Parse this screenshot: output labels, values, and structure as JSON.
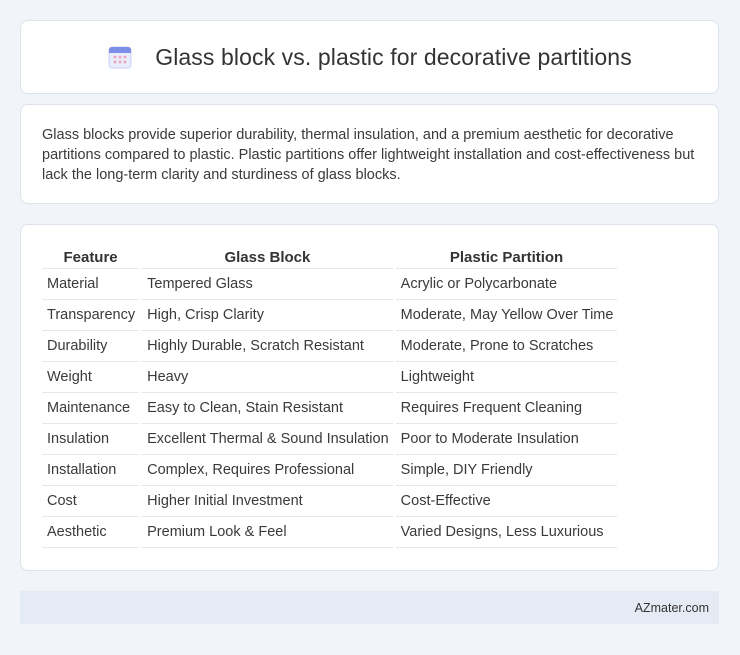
{
  "header": {
    "title": "Glass block vs. plastic for decorative partitions",
    "icon": "calendar-icon"
  },
  "intro": {
    "text": "Glass blocks provide superior durability, thermal insulation, and a premium aesthetic for decorative partitions compared to plastic. Plastic partitions offer lightweight installation and cost-effectiveness but lack the long-term clarity and sturdiness of glass blocks."
  },
  "table": {
    "headers": [
      "Feature",
      "Glass Block",
      "Plastic Partition"
    ],
    "rows": [
      [
        "Material",
        "Tempered Glass",
        "Acrylic or Polycarbonate"
      ],
      [
        "Transparency",
        "High, Crisp Clarity",
        "Moderate, May Yellow Over Time"
      ],
      [
        "Durability",
        "Highly Durable, Scratch Resistant",
        "Moderate, Prone to Scratches"
      ],
      [
        "Weight",
        "Heavy",
        "Lightweight"
      ],
      [
        "Maintenance",
        "Easy to Clean, Stain Resistant",
        "Requires Frequent Cleaning"
      ],
      [
        "Insulation",
        "Excellent Thermal & Sound Insulation",
        "Poor to Moderate Insulation"
      ],
      [
        "Installation",
        "Complex, Requires Professional",
        "Simple, DIY Friendly"
      ],
      [
        "Cost",
        "Higher Initial Investment",
        "Cost-Effective"
      ],
      [
        "Aesthetic",
        "Premium Look & Feel",
        "Varied Designs, Less Luxurious"
      ]
    ]
  },
  "footer": {
    "brand": "AZmater.com"
  }
}
